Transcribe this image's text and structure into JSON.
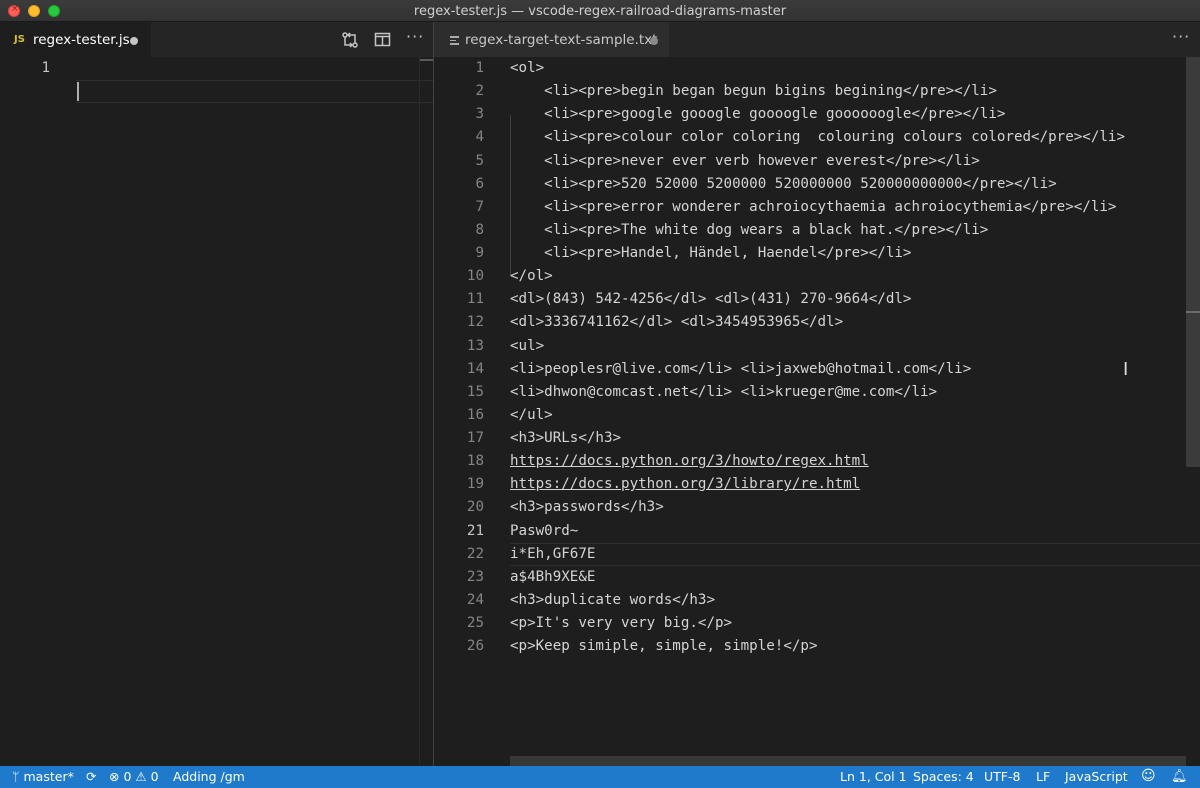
{
  "window": {
    "title": "regex-tester.js — vscode-regex-railroad-diagrams-master"
  },
  "left_editor": {
    "tab": {
      "icon_badge": "JS",
      "label": "regex-tester.js"
    },
    "lines": [
      "1"
    ]
  },
  "right_editor": {
    "tab": {
      "label": "regex-target-text-sample.txt"
    },
    "line_numbers": [
      "1",
      "2",
      "3",
      "4",
      "5",
      "6",
      "7",
      "8",
      "9",
      "10",
      "11",
      "12",
      "13",
      "14",
      "15",
      "16",
      "17",
      "18",
      "19",
      "20",
      "21",
      "22",
      "23",
      "24",
      "25",
      "26"
    ],
    "lines": [
      "<ol>",
      "    <li><pre>begin began begun bigins begining</pre></li>",
      "    <li><pre>google gooogle goooogle goooooogle</pre></li>",
      "    <li><pre>colour color coloring  colouring colours colored</pre></li>",
      "    <li><pre>never ever verb however everest</pre></li>",
      "    <li><pre>520 52000 5200000 520000000 520000000000</pre></li>",
      "    <li><pre>error wonderer achroiocythaemia achroiocythemia</pre></li>",
      "    <li><pre>The white dog wears a black hat.</pre></li>",
      "    <li><pre>Handel, Händel, Haendel</pre></li>",
      "</ol>",
      "<dl>(843) 542-4256</dl> <dl>(431) 270-9664</dl>",
      "<dl>3336741162</dl> <dl>3454953965</dl>",
      "<ul>",
      "<li>peoplesr@live.com</li> <li>jaxweb@hotmail.com</li>",
      "<li>dhwon@comcast.net</li> <li>krueger@me.com</li>",
      "</ul>",
      "<h3>URLs</h3>",
      "https://docs.python.org/3/howto/regex.html",
      "https://docs.python.org/3/library/re.html",
      "<h3>passwords</h3>",
      "Pasw0rd~",
      "i*Eh,GF67E",
      "a$4Bh9XE&E",
      "<h3>duplicate words</h3>",
      "<p>It's very very big.</p>",
      "<p>Keep simiple, simple, simple!</p>"
    ]
  },
  "status_bar": {
    "branch": "master*",
    "errors": "0",
    "warnings": "0",
    "message": "Adding /gm",
    "position": "Ln 1, Col 1",
    "indent": "Spaces: 4",
    "encoding": "UTF-8",
    "eol": "LF",
    "language": "JavaScript"
  },
  "colors": {
    "status_bar": "#1f7acc",
    "editor_bg": "#1e1e1e",
    "js_badge": "#d4be3a"
  }
}
